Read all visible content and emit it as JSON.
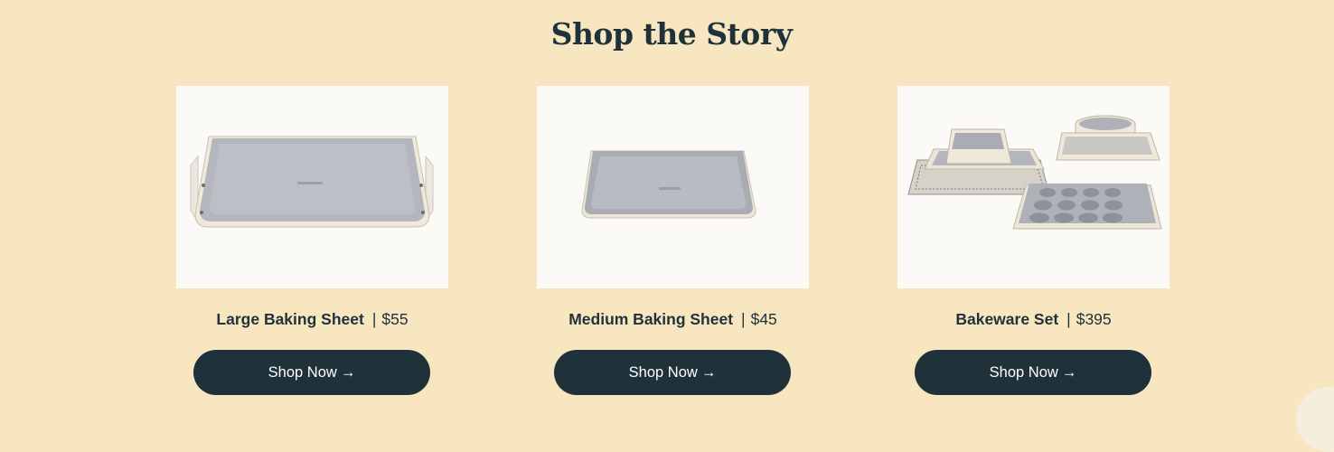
{
  "section": {
    "title": "Shop the Story"
  },
  "products": [
    {
      "name": "Large Baking Sheet",
      "separator": "|",
      "price": "$55",
      "button_label": "Shop Now",
      "button_arrow": "→",
      "image_icon": "large-baking-sheet-image"
    },
    {
      "name": "Medium Baking Sheet",
      "separator": "|",
      "price": "$45",
      "button_label": "Shop Now",
      "button_arrow": "→",
      "image_icon": "medium-baking-sheet-image"
    },
    {
      "name": "Bakeware Set",
      "separator": "|",
      "price": "$395",
      "button_label": "Shop Now",
      "button_arrow": "→",
      "image_icon": "bakeware-set-image"
    }
  ],
  "colors": {
    "background": "#f7e6c0",
    "text": "#1f323a",
    "button": "#1f323a",
    "button_text": "#ffffff",
    "image_bg": "#fbfaf7"
  }
}
